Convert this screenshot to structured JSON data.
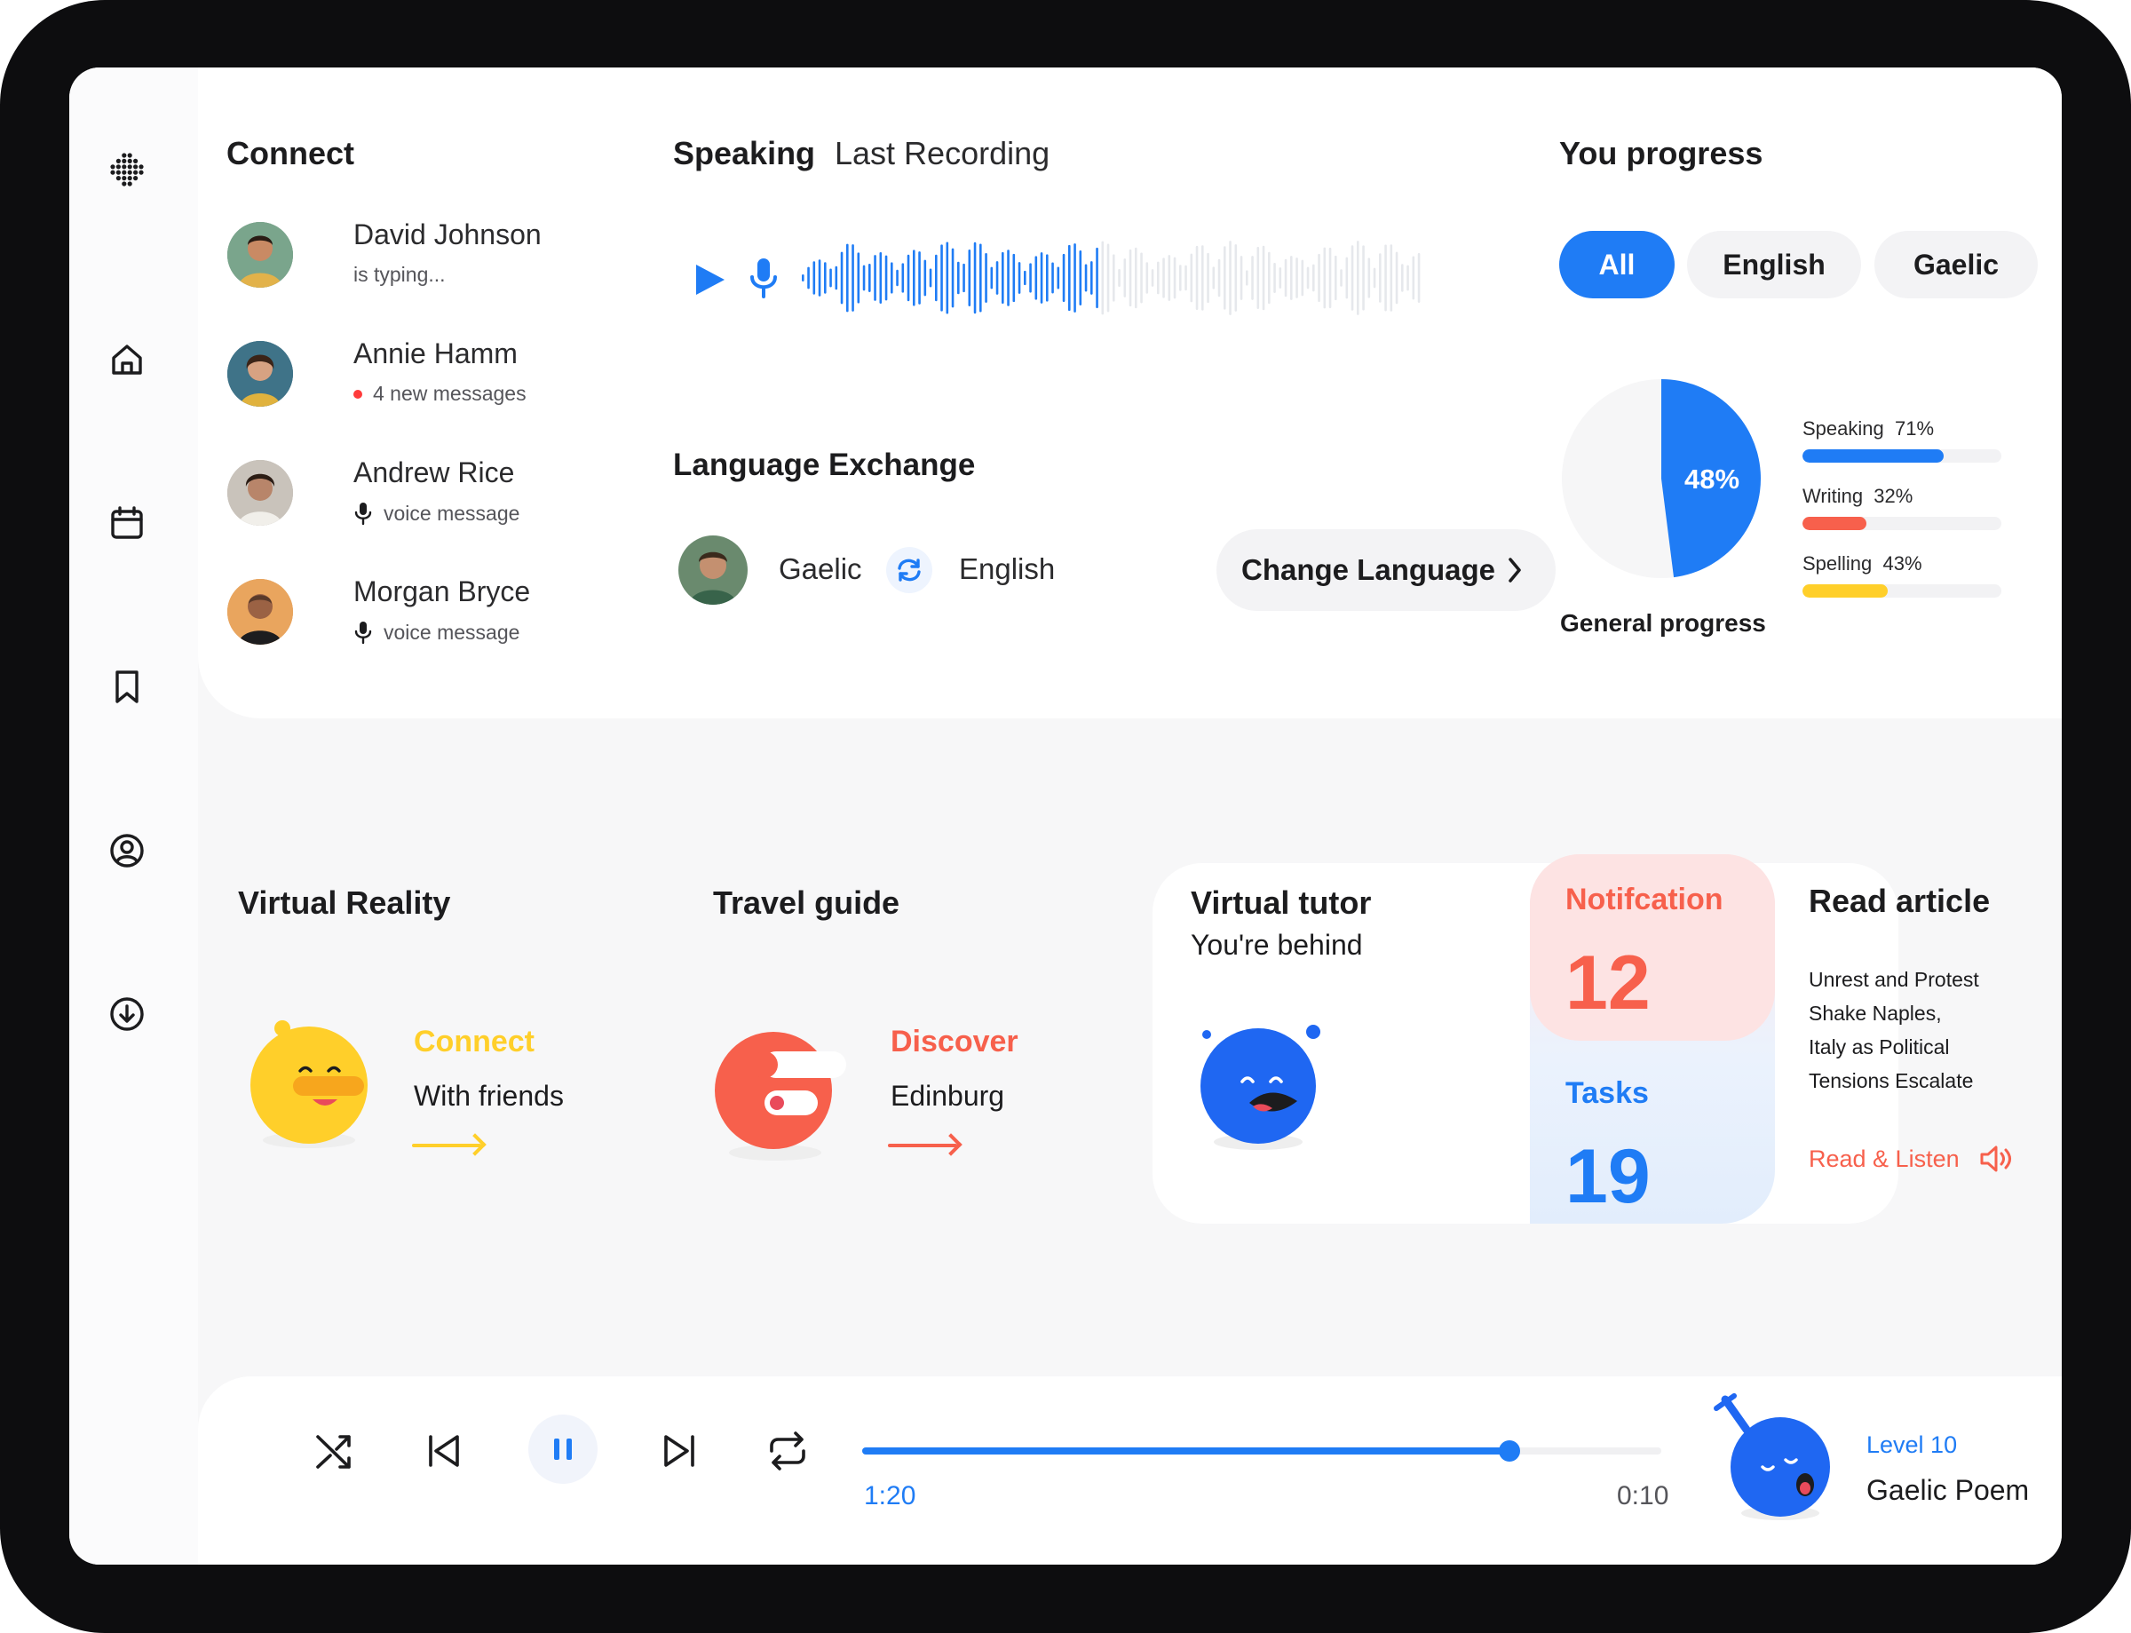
{
  "connect": {
    "title": "Connect",
    "contacts": [
      {
        "name": "David Johnson",
        "status": "is typing..."
      },
      {
        "name": "Annie Hamm",
        "status": "4 new messages"
      },
      {
        "name": "Andrew Rice",
        "status": "voice message"
      },
      {
        "name": "Morgan Bryce",
        "status": "voice message"
      }
    ]
  },
  "speaking": {
    "title": "Speaking",
    "subtitle": "Last Recording"
  },
  "exchange": {
    "title": "Language Exchange",
    "from": "Gaelic",
    "to": "English",
    "button": "Change Language"
  },
  "progress": {
    "title": "You progress",
    "filters": [
      "All",
      "English",
      "Gaelic"
    ],
    "active_filter": "All",
    "general_label": "General progress",
    "general_value": "48%",
    "general_fraction": 0.48,
    "skills": [
      {
        "label": "Speaking",
        "percent_text": "71%",
        "value": 71,
        "color": "#1f7cf5"
      },
      {
        "label": "Writing",
        "percent_text": "32%",
        "value": 32,
        "color": "#f7604c"
      },
      {
        "label": "Spelling",
        "percent_text": "43%",
        "value": 43,
        "color": "#ffcf2a"
      }
    ]
  },
  "features": {
    "vr": {
      "title": "Virtual Reality",
      "accent": "Connect",
      "text": "With friends"
    },
    "travel": {
      "title": "Travel guide",
      "accent": "Discover",
      "text": "Edinburg"
    },
    "tutor": {
      "title": "Virtual tutor",
      "text": "You're behind"
    },
    "notification": {
      "label": "Notifcation",
      "value": "12"
    },
    "tasks": {
      "label": "Tasks",
      "value": "19"
    },
    "article": {
      "title": "Read article",
      "lines": [
        "Unrest and Protest",
        "Shake Naples,",
        "Italy as Political",
        "Tensions Escalate"
      ],
      "link": "Read & Listen"
    }
  },
  "player": {
    "elapsed": "1:20",
    "remaining": "0:10",
    "progress": 0.81,
    "level": "Level 10",
    "track": "Gaelic Poem"
  },
  "colors": {
    "blue": "#1f7cf5",
    "red": "#f7604c",
    "yellow": "#ffcf2a",
    "text": "#1c1c1e"
  }
}
